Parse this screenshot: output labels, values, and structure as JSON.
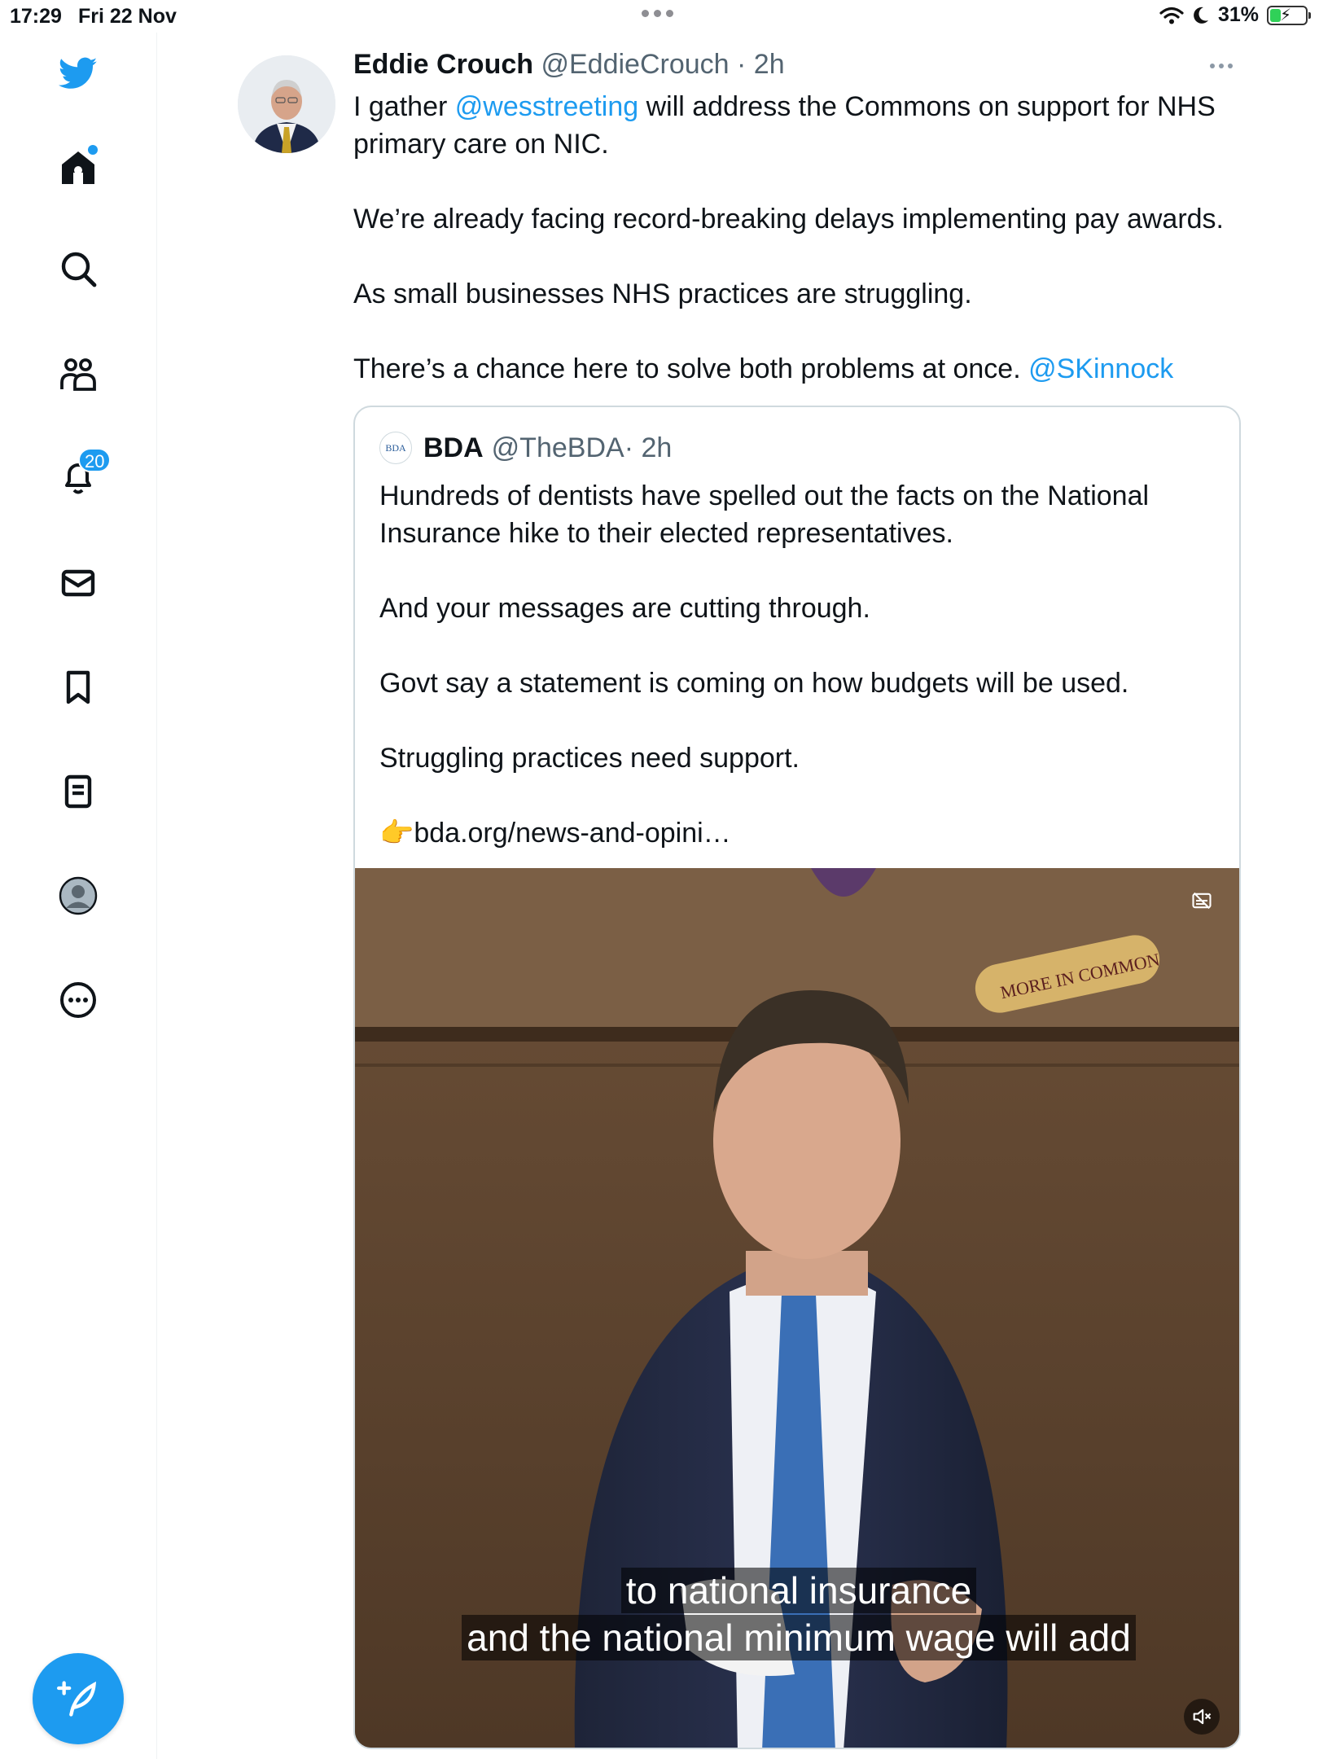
{
  "status_bar": {
    "time": "17:29",
    "date": "Fri 22 Nov",
    "battery_pct": "31%",
    "battery_level": 0.31
  },
  "sidebar": {
    "items": [
      {
        "id": "logo",
        "icon": "twitter-bird-icon"
      },
      {
        "id": "home",
        "icon": "home-icon",
        "has_dot": true
      },
      {
        "id": "explore",
        "icon": "search-icon"
      },
      {
        "id": "communities",
        "icon": "communities-icon"
      },
      {
        "id": "notifications",
        "icon": "bell-icon",
        "badge": "20"
      },
      {
        "id": "messages",
        "icon": "mail-icon"
      },
      {
        "id": "bookmarks",
        "icon": "bookmark-icon"
      },
      {
        "id": "lists",
        "icon": "list-icon"
      },
      {
        "id": "profile",
        "icon": "profile-avatar-icon"
      },
      {
        "id": "more",
        "icon": "more-circle-icon"
      }
    ],
    "compose_icon": "compose-tweet-icon",
    "accent_color": "#1d9bf0"
  },
  "tweet": {
    "name": "Eddie Crouch",
    "handle": "@EddieCrouch",
    "time": "· 2h",
    "p1": {
      "pre": "I gather ",
      "mention": "@wesstreeting",
      "post": " will address the Commons on support for NHS primary care on NIC."
    },
    "p2": "We’re already facing record-breaking delays implementing pay awards.",
    "p3": "As small businesses NHS practices are struggling.",
    "p4": {
      "pre": "There’s a chance here to solve both problems at once. ",
      "mention": "@SKinnock"
    }
  },
  "quoted": {
    "avatar_text": "BDA",
    "name": "BDA",
    "handle": "@TheBDA",
    "time": "· 2h",
    "p1": "Hundreds of dentists have spelled out the facts on the National Insurance hike to their elected representatives.",
    "p2": "And your messages are cutting through.",
    "p3": "Govt say a statement is coming on how budgets will be used.",
    "p4": "Struggling practices need support.",
    "link_emoji": "👉",
    "link": "bda.org/news-and-opini…",
    "video": {
      "caption1": "to national insurance",
      "caption2": "and the national minimum wage will add",
      "banner": "MORE IN COMMON"
    }
  }
}
